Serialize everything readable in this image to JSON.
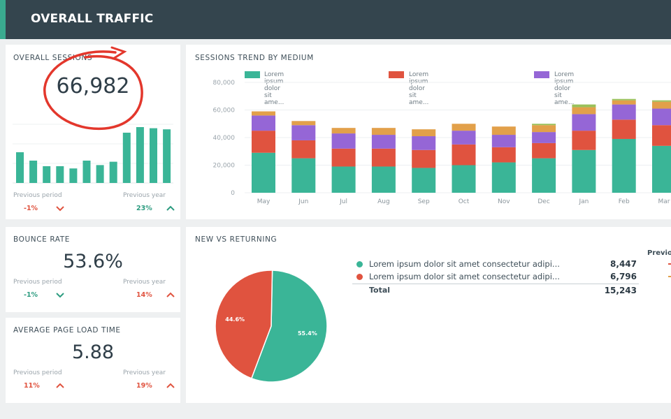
{
  "header": {
    "title": "OVERALL TRAFFIC"
  },
  "sessions": {
    "title": "OVERALL SESSIONS",
    "value": "66,982",
    "prev_period_label": "Previous period",
    "prev_period_value": "-1%",
    "prev_year_label": "Previous year",
    "prev_year_value": "23%",
    "sparkline": [
      0.55,
      0.4,
      0.3,
      0.3,
      0.26,
      0.4,
      0.32,
      0.38,
      0.9,
      1.0,
      0.98,
      0.96
    ]
  },
  "bounce": {
    "title": "BOUNCE RATE",
    "value": "53.6%",
    "prev_period_label": "Previous period",
    "prev_period_value": "-1%",
    "prev_year_label": "Previous year",
    "prev_year_value": "14%"
  },
  "load": {
    "title": "AVERAGE PAGE LOAD TIME",
    "value": "5.88",
    "prev_period_label": "Previous period",
    "prev_period_value": "11%",
    "prev_year_label": "Previous year",
    "prev_year_value": "19%"
  },
  "trend": {
    "title": "SESSIONS TREND BY MEDIUM"
  },
  "new_returning": {
    "title": "NEW VS RETURNING",
    "rows": [
      {
        "label": "Lorem ipsum dolor sit amet consectetur adipi...",
        "value": "8,447",
        "color": "#3ab597"
      },
      {
        "label": "Lorem ipsum dolor sit amet consectetur adipi...",
        "value": "6,796",
        "color": "#e0533f"
      }
    ],
    "total_label": "Total",
    "total_value": "15,243",
    "previous_header": "Previo",
    "pie_labels": [
      "55.4%",
      "44.6%"
    ]
  },
  "chart_data": {
    "type": "bar",
    "stacked": true,
    "categories": [
      "May",
      "Jun",
      "Jul",
      "Aug",
      "Sep",
      "Oct",
      "Nov",
      "Dec",
      "Jan",
      "Feb",
      "Mar"
    ],
    "ylim": [
      0,
      80000
    ],
    "yticks": [
      "80,000",
      "60,000",
      "40,000",
      "20,000",
      "0"
    ],
    "grid": true,
    "legend_position": "top",
    "series": [
      {
        "name": "Lorem ipsum dolor sit ame...",
        "color": "#3ab597",
        "values": [
          29000,
          25000,
          19000,
          19000,
          18000,
          20000,
          22000,
          25000,
          31000,
          39000,
          34000
        ]
      },
      {
        "name": "Lorem ipsum dolor sit ame...",
        "color": "#e0533f",
        "values": [
          16000,
          13000,
          13000,
          13000,
          13000,
          15000,
          11000,
          11000,
          14000,
          14000,
          15000
        ]
      },
      {
        "name": "Lorem ipsum dolor sit ame...",
        "color": "#9566d6",
        "values": [
          11000,
          11000,
          11000,
          10000,
          10000,
          10000,
          9000,
          8000,
          12000,
          11000,
          12000
        ]
      },
      {
        "name": "",
        "color": "#e2a04a",
        "values": [
          3000,
          3000,
          4000,
          5000,
          5000,
          5000,
          6000,
          5000,
          5000,
          3000,
          5000
        ]
      },
      {
        "name": "",
        "color": "#9ac15a",
        "values": [
          0,
          0,
          0,
          0,
          0,
          0,
          0,
          1000,
          2000,
          1000,
          1000
        ]
      }
    ]
  }
}
